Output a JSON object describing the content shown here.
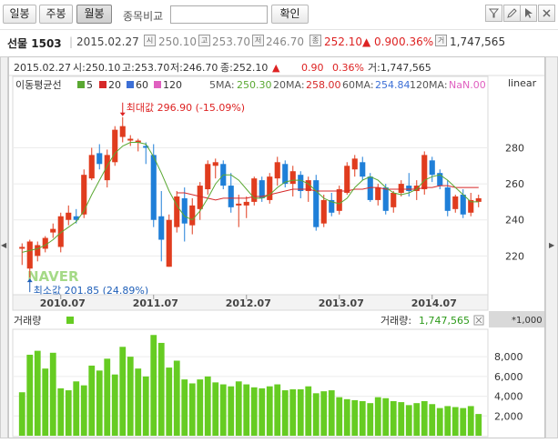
{
  "toolbar": {
    "tabs": [
      "일봉",
      "주봉",
      "월봉"
    ],
    "active_tab": "월봉",
    "compare_label": "종목비교",
    "compare_input_value": "",
    "confirm_label": "확인",
    "tool_icons": [
      "filter-icon",
      "pencil-icon",
      "pointer-icon",
      "panel-toggle-icon",
      "close-icon"
    ]
  },
  "quote": {
    "name": "선물 1503",
    "date": "2015.02.27",
    "open_icon": "시",
    "open": "250.10",
    "high_icon": "고",
    "high": "253.70",
    "low_icon": "저",
    "low": "246.70",
    "close_icon": "종",
    "close": "252.10",
    "change": "▲ 0.90",
    "change_pct": "0.36%",
    "volume_icon": "거",
    "volume": "1,747,565"
  },
  "colors": {
    "up": "#e03c1e",
    "down": "#1f7fd8",
    "ma5": "#5aa832",
    "ma20": "#d62828",
    "ma60": "#3c6fd6",
    "ma120": "#e060c0",
    "volume_bar": "#66cc22",
    "accent_green": "#2d9a1a"
  },
  "chart_data": {
    "type": "candlestick",
    "info_line": {
      "date": "2015.02.27",
      "open": "시:250.10",
      "high": "고:253.70",
      "low": "저:246.70",
      "close": "종:252.10",
      "arrow": "▲",
      "change": "0.90",
      "change_pct": "0.36%",
      "volume": "거:1,747,565"
    },
    "legend": {
      "title": "이동평균선",
      "items": [
        {
          "label": "5",
          "color": "#5aa832"
        },
        {
          "label": "20",
          "color": "#d62828"
        },
        {
          "label": "60",
          "color": "#3c6fd6"
        },
        {
          "label": "120",
          "color": "#e060c0"
        }
      ],
      "values": [
        {
          "label": "5MA:",
          "value": "250.30",
          "color": "#5aa832"
        },
        {
          "label": "20MA:",
          "value": "258.00",
          "color": "#d62828"
        },
        {
          "label": "60MA:",
          "value": "254.84",
          "color": "#3c6fd6"
        },
        {
          "label": "120MA:",
          "value": "NaN.00",
          "color": "#e060c0"
        }
      ]
    },
    "scale": "linear",
    "ylim": [
      200,
      310
    ],
    "y_ticks": [
      220,
      240,
      260,
      280
    ],
    "x_ticks": [
      "2010.07",
      "2011.07",
      "2012.07",
      "2013.07",
      "2014.07"
    ],
    "max_label": "최대값 296.90 (-15.09%)",
    "min_label": "최소값 201.85 (24.89%)",
    "watermark": "NAVER",
    "candles": [
      {
        "o": 224,
        "h": 227,
        "l": 215,
        "c": 225
      },
      {
        "o": 213,
        "h": 229,
        "l": 208,
        "c": 228
      },
      {
        "o": 220,
        "h": 228,
        "l": 217,
        "c": 226
      },
      {
        "o": 224,
        "h": 231,
        "l": 222,
        "c": 230
      },
      {
        "o": 233,
        "h": 238,
        "l": 230,
        "c": 235
      },
      {
        "o": 225,
        "h": 244,
        "l": 222,
        "c": 242
      },
      {
        "o": 240,
        "h": 248,
        "l": 237,
        "c": 244
      },
      {
        "o": 242,
        "h": 246,
        "l": 238,
        "c": 240
      },
      {
        "o": 243,
        "h": 268,
        "l": 241,
        "c": 265
      },
      {
        "o": 263,
        "h": 280,
        "l": 262,
        "c": 276
      },
      {
        "o": 277,
        "h": 282,
        "l": 268,
        "c": 271
      },
      {
        "o": 262,
        "h": 279,
        "l": 258,
        "c": 276
      },
      {
        "o": 272,
        "h": 292,
        "l": 270,
        "c": 290
      },
      {
        "o": 286,
        "h": 297,
        "l": 283,
        "c": 292
      },
      {
        "o": 284,
        "h": 287,
        "l": 281,
        "c": 285
      },
      {
        "o": 283,
        "h": 285,
        "l": 278,
        "c": 284
      },
      {
        "o": 281,
        "h": 283,
        "l": 271,
        "c": 280
      },
      {
        "o": 276,
        "h": 282,
        "l": 236,
        "c": 240
      },
      {
        "o": 242,
        "h": 256,
        "l": 217,
        "c": 229
      },
      {
        "o": 214,
        "h": 243,
        "l": 214,
        "c": 240
      },
      {
        "o": 236,
        "h": 256,
        "l": 233,
        "c": 253
      },
      {
        "o": 252,
        "h": 258,
        "l": 228,
        "c": 238
      },
      {
        "o": 237,
        "h": 252,
        "l": 232,
        "c": 248
      },
      {
        "o": 246,
        "h": 261,
        "l": 240,
        "c": 259
      },
      {
        "o": 257,
        "h": 273,
        "l": 254,
        "c": 271
      },
      {
        "o": 270,
        "h": 274,
        "l": 263,
        "c": 272
      },
      {
        "o": 271,
        "h": 273,
        "l": 257,
        "c": 259
      },
      {
        "o": 259,
        "h": 266,
        "l": 244,
        "c": 247
      },
      {
        "o": 248,
        "h": 254,
        "l": 236,
        "c": 249
      },
      {
        "o": 248,
        "h": 253,
        "l": 241,
        "c": 250
      },
      {
        "o": 250,
        "h": 264,
        "l": 248,
        "c": 263
      },
      {
        "o": 262,
        "h": 264,
        "l": 250,
        "c": 252
      },
      {
        "o": 251,
        "h": 266,
        "l": 249,
        "c": 264
      },
      {
        "o": 263,
        "h": 275,
        "l": 259,
        "c": 272
      },
      {
        "o": 271,
        "h": 273,
        "l": 258,
        "c": 260
      },
      {
        "o": 260,
        "h": 270,
        "l": 253,
        "c": 267
      },
      {
        "o": 265,
        "h": 267,
        "l": 252,
        "c": 256
      },
      {
        "o": 256,
        "h": 264,
        "l": 250,
        "c": 262
      },
      {
        "o": 262,
        "h": 265,
        "l": 234,
        "c": 236
      },
      {
        "o": 238,
        "h": 254,
        "l": 236,
        "c": 251
      },
      {
        "o": 251,
        "h": 255,
        "l": 242,
        "c": 244
      },
      {
        "o": 245,
        "h": 259,
        "l": 243,
        "c": 257
      },
      {
        "o": 255,
        "h": 272,
        "l": 254,
        "c": 270
      },
      {
        "o": 268,
        "h": 276,
        "l": 264,
        "c": 274
      },
      {
        "o": 272,
        "h": 275,
        "l": 262,
        "c": 264
      },
      {
        "o": 264,
        "h": 266,
        "l": 250,
        "c": 251
      },
      {
        "o": 251,
        "h": 260,
        "l": 248,
        "c": 258
      },
      {
        "o": 258,
        "h": 260,
        "l": 243,
        "c": 245
      },
      {
        "o": 247,
        "h": 256,
        "l": 244,
        "c": 255
      },
      {
        "o": 255,
        "h": 262,
        "l": 253,
        "c": 260
      },
      {
        "o": 259,
        "h": 266,
        "l": 253,
        "c": 256
      },
      {
        "o": 256,
        "h": 262,
        "l": 251,
        "c": 259
      },
      {
        "o": 257,
        "h": 278,
        "l": 254,
        "c": 276
      },
      {
        "o": 273,
        "h": 275,
        "l": 261,
        "c": 265
      },
      {
        "o": 266,
        "h": 268,
        "l": 257,
        "c": 259
      },
      {
        "o": 258,
        "h": 262,
        "l": 242,
        "c": 245
      },
      {
        "o": 246,
        "h": 254,
        "l": 244,
        "c": 253
      },
      {
        "o": 254,
        "h": 257,
        "l": 241,
        "c": 243
      },
      {
        "o": 244,
        "h": 255,
        "l": 242,
        "c": 251
      },
      {
        "o": 250,
        "h": 254,
        "l": 247,
        "c": 252
      }
    ],
    "ma5": [
      222,
      223,
      224,
      226,
      229,
      233,
      236,
      239,
      245,
      254,
      262,
      270,
      277,
      281,
      283,
      283,
      282,
      275,
      266,
      256,
      248,
      242,
      240,
      245,
      252,
      260,
      265,
      265,
      262,
      257,
      252,
      252,
      254,
      258,
      261,
      262,
      262,
      260,
      256,
      252,
      250,
      249,
      252,
      258,
      262,
      264,
      262,
      258,
      255,
      254,
      255,
      257,
      262,
      264,
      265,
      262,
      258,
      254,
      250,
      250
    ],
    "ma20": [
      null,
      null,
      null,
      null,
      null,
      null,
      null,
      null,
      null,
      null,
      null,
      null,
      null,
      null,
      null,
      null,
      null,
      null,
      null,
      null,
      255,
      255,
      254,
      253,
      252,
      251,
      252,
      252,
      252,
      252,
      253,
      253,
      254,
      255,
      256,
      257,
      257,
      257,
      256,
      256,
      256,
      256,
      256,
      257,
      257,
      258,
      258,
      257,
      257,
      257,
      257,
      257,
      258,
      258,
      259,
      259,
      258,
      258,
      258,
      258
    ],
    "volume_title": "거래량",
    "volume_label": "거래량:",
    "volume_value": "1,747,565",
    "volume_scale_label": "*1,000",
    "volume_ylim": [
      0,
      10500
    ],
    "volume_ticks": [
      "2,000",
      "4,000",
      "6,000",
      "8,000"
    ],
    "volume": [
      4400,
      8200,
      8600,
      6800,
      8400,
      4800,
      4600,
      5500,
      5100,
      7100,
      6600,
      7800,
      6200,
      9000,
      8000,
      6800,
      6000,
      10200,
      9400,
      6900,
      7600,
      5700,
      5300,
      5700,
      6000,
      5400,
      5200,
      5000,
      5500,
      5200,
      4900,
      4800,
      5000,
      5200,
      4600,
      4700,
      4700,
      5000,
      4300,
      4500,
      4600,
      3900,
      3700,
      3600,
      3500,
      3300,
      3900,
      3800,
      3500,
      3400,
      3100,
      3300,
      3500,
      3200,
      2800,
      3000,
      2900,
      2800,
      3000,
      2200
    ]
  }
}
